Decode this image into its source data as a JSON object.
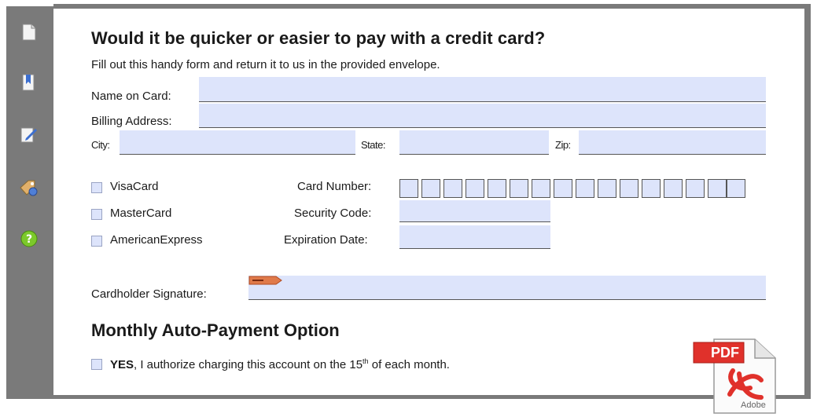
{
  "form": {
    "title": "Would it be quicker or easier to pay with a credit card?",
    "subtitle": "Fill out this handy form and return it to us in the provided envelope.",
    "name_label": "Name on Card:",
    "address_label": "Billing Address:",
    "city_label": "City:",
    "state_label": "State:",
    "zip_label": "Zip:",
    "card_types": [
      "VisaCard",
      "MasterCard",
      "AmericanExpress"
    ],
    "card_number_label": "Card Number:",
    "security_label": "Security Code:",
    "expiration_label": "Expiration Date:",
    "signature_label": "Cardholder Signature:",
    "section_title": "Monthly Auto-Payment Option",
    "auth_yes": "YES",
    "auth_text": ", I authorize charging this account on the 15",
    "auth_sup": "th",
    "auth_end": " of each month."
  },
  "pdf_badge": {
    "label": "PDF",
    "brand": "Adobe"
  },
  "colors": {
    "field": "#dde4fb",
    "toolbar": "#7a7a7a",
    "pdf_red": "#e0312b"
  },
  "icons": [
    "page-icon",
    "bookmark-icon",
    "edit-icon",
    "attachment-icon",
    "help-icon"
  ]
}
